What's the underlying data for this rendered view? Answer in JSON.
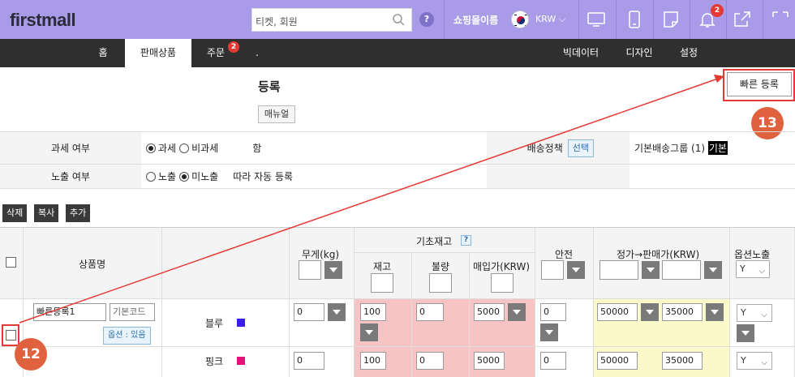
{
  "topbar": {
    "logo": "firstmall",
    "search_placeholder": "티켓, 회원",
    "help": "?",
    "shop_name": "쇼핑몰이름",
    "currency": "KRW",
    "notification_count": "2"
  },
  "menu": {
    "items": [
      {
        "label": "홈"
      },
      {
        "label": "판매상품"
      },
      {
        "label": "주문",
        "badge": "2"
      },
      {
        "label": "."
      },
      {
        "label": "빅데이터"
      },
      {
        "label": "디자인"
      },
      {
        "label": "설정"
      }
    ]
  },
  "page": {
    "title": "등록",
    "quick_register": "빠른 등록",
    "manual": "매뉴얼"
  },
  "callouts": {
    "a": "13",
    "b": "12"
  },
  "settings": {
    "tax_label": "과세 여부",
    "tax_on": "과세",
    "tax_off": "비과세",
    "tax_extra": "함",
    "shipping_label": "배송정책",
    "shipping_select": "선택",
    "shipping_value_prefix": "기본배송그룹 (1)",
    "shipping_value_hl": "기본",
    "display_label": "노출 여부",
    "display_on": "노출",
    "display_off": "미노출",
    "display_extra": "따라 자동 등록"
  },
  "actions": {
    "delete": "삭제",
    "copy": "복사",
    "add": "추가"
  },
  "table": {
    "headers": {
      "product_name": "상품명",
      "weight": "무게(kg)",
      "base_stock": "기초재고",
      "stock": "재고",
      "defect": "불량",
      "purchase": "매입가(KRW)",
      "safety": "안전",
      "price": "정가→판매가(KRW)",
      "option_display": "옵션노출",
      "opt_display_value": "Y"
    },
    "row1": {
      "name": "빠른등록1",
      "code_placeholder": "기본코드",
      "option_badge": "옵션 : 있음",
      "color_name": "블루",
      "weight": "0",
      "stock": "100",
      "defect": "0",
      "purchase": "5000",
      "safety": "0",
      "list_price": "50000",
      "sale_price": "35000",
      "opt_display": "Y"
    },
    "row2": {
      "color_name": "핑크",
      "weight": "0",
      "stock": "100",
      "defect": "0",
      "purchase": "5000",
      "safety": "0",
      "list_price": "50000",
      "sale_price": "35000",
      "opt_display": "Y"
    }
  },
  "colors": {
    "blue_swatch": "#3a1cf0",
    "pink_swatch": "#e6117a",
    "callout": "#e0613d",
    "accent_red": "#e53935"
  }
}
